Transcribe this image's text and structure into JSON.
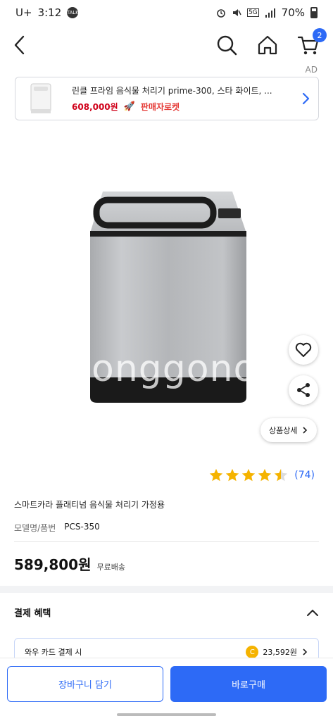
{
  "status_bar": {
    "carrier": "U+",
    "time": "3:12",
    "talk_badge": "TALK",
    "battery": "70%",
    "network": "5G"
  },
  "header": {
    "cart_count": "2",
    "icons": [
      "back-arrow-icon",
      "search-icon",
      "home-icon",
      "cart-icon"
    ]
  },
  "ad": {
    "label": "AD",
    "title": "린클 프라임 음식물 처리기 prime-300, 스타 화이트, ...",
    "price": "608,000원",
    "rocket_label": "판매자로켓"
  },
  "product_image": {
    "watermark": "onggono"
  },
  "detail_button": {
    "label": "상품상세"
  },
  "rating": {
    "stars": 4.5,
    "review_count": "(74)"
  },
  "product": {
    "title": "스마트카라 플래티넘 음식물 처리기 가정용",
    "model_label": "모델명/품번",
    "model_value": "PCS-350",
    "price": "589,800원",
    "shipping": "무료배송"
  },
  "benefit": {
    "title": "결제 혜택",
    "card_label": "와우 카드 결제 시",
    "card_value": "23,592원"
  },
  "actions": {
    "add_to_cart": "장바구니 담기",
    "buy_now": "바로구매"
  },
  "colors": {
    "accent": "#2d6af6",
    "star": "#f5b300",
    "ad_price": "#d0021b"
  }
}
